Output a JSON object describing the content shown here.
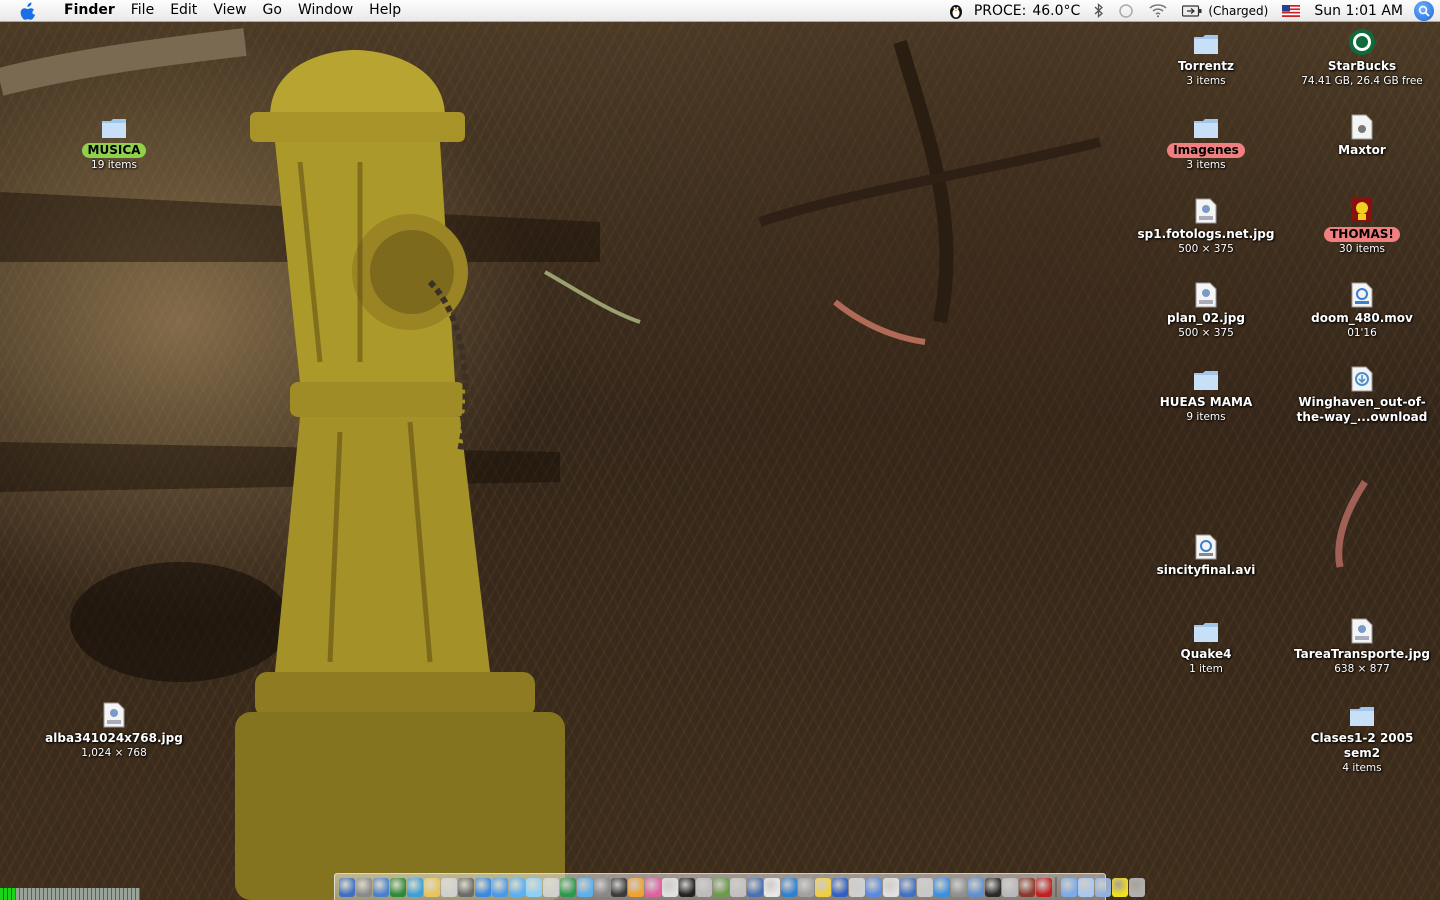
{
  "menubar": {
    "apple_icon": "apple-icon",
    "app_name": "Finder",
    "menus": [
      "File",
      "Edit",
      "View",
      "Go",
      "Window",
      "Help"
    ],
    "extras": {
      "temp_label": "PROCE:",
      "temp_value": "46.0°C",
      "battery_status": "(Charged)",
      "clock": "Sun 1:01 AM"
    }
  },
  "desktop": {
    "icons": [
      {
        "name": "Torrentz",
        "info": "3 items",
        "kind": "folder"
      },
      {
        "name": "StarBucks",
        "info": "74.41 GB, 26.4 GB free",
        "kind": "disk"
      },
      {
        "name": "MUSICA",
        "info": "19 items",
        "kind": "folder",
        "label": "green"
      },
      {
        "name": "Imagenes",
        "info": "3 items",
        "kind": "folder",
        "label": "red"
      },
      {
        "name": "Maxtor",
        "info": "",
        "kind": "doc"
      },
      {
        "name": "sp1.fotologs.net.jpg",
        "info": "500 × 375",
        "kind": "jpeg"
      },
      {
        "name": "THOMAS!",
        "info": "30 items",
        "kind": "custom",
        "label": "red"
      },
      {
        "name": "plan_02.jpg",
        "info": "500 × 375",
        "kind": "jpeg"
      },
      {
        "name": "doom_480.mov",
        "info": "01'16",
        "kind": "movie"
      },
      {
        "name": "HUEAS MAMA",
        "info": "9 items",
        "kind": "folder"
      },
      {
        "name": "Winghaven_out-of-the-way_...ownload",
        "info": "",
        "kind": "download"
      },
      {
        "name": "sincityfinal.avi",
        "info": "",
        "kind": "avi"
      },
      {
        "name": "Quake4",
        "info": "1 item",
        "kind": "folder"
      },
      {
        "name": "TareaTransporte.jpg",
        "info": "638 × 877",
        "kind": "jpeg"
      },
      {
        "name": "alba341024x768.jpg",
        "info": "1,024 × 768",
        "kind": "jpeg"
      },
      {
        "name": "Clases1-2 2005 sem2",
        "info": "4 items",
        "kind": "folder"
      }
    ]
  },
  "dock": {
    "colors": [
      "#3d6fc2",
      "#8a8a8a",
      "#4a7fd0",
      "#2a8a3a",
      "#3aa0d8",
      "#e8c45a",
      "#d0d0d0",
      "#6a6a6a",
      "#3a88e0",
      "#4a9ae8",
      "#5cb0f0",
      "#8ad0f8",
      "#d0d0d0",
      "#2a9a4a",
      "#5ab0e8",
      "#888888",
      "#3a3a3a",
      "#f0a030",
      "#e060a0",
      "#e0e0e0",
      "#222222",
      "#bbbbbb",
      "#6a9a4a",
      "#c0c0c0",
      "#4a70b0",
      "#e8e8e8",
      "#3080d0",
      "#a0a0a0",
      "#f0d040",
      "#3060c0",
      "#d0d0d0",
      "#5a8ae0",
      "#e0e0e0",
      "#4070c0",
      "#c8c8c8",
      "#3a90e0",
      "#909090",
      "#6090d0",
      "#2a2a2a",
      "#b8b8b8",
      "#8a3a2a",
      "#c02020",
      "#7aaae8",
      "#a8c8f0",
      "#90b0e0",
      "#f0e020",
      "#b0b0b0"
    ],
    "separator_after": 41
  },
  "activity_meter": {
    "level": 0.11
  }
}
